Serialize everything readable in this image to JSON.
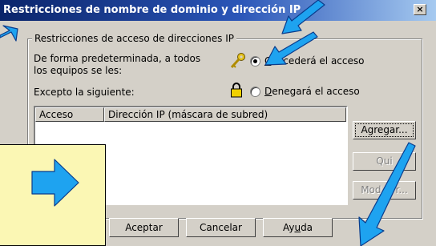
{
  "window": {
    "title": "Restricciones de nombre de dominio y dirección IP",
    "close_glyph": "×"
  },
  "group": {
    "label": "Restricciones de acceso de direcciones IP"
  },
  "default_access": {
    "line1": "De forma predeterminada, a todos",
    "line2": "los equipos se les:"
  },
  "grant_option": {
    "label_pre": "",
    "label_u": "C",
    "label_post": "oncederá el acceso",
    "selected": true
  },
  "deny_option": {
    "label_pre": "",
    "label_u": "D",
    "label_post": "enegará el acceso",
    "selected": false
  },
  "exception_label": "Excepto la siguiente:",
  "table": {
    "columns": [
      "Acceso",
      "Dirección IP (máscara de subred)"
    ],
    "rows": []
  },
  "side_buttons": {
    "add": "Agregar...",
    "remove": "Qui",
    "edit_pre": "Mod",
    "edit_post": "r..."
  },
  "footer": {
    "ok": "Aceptar",
    "cancel": "Cancelar",
    "help_pre": "Ay",
    "help_u": "u",
    "help_post": "da"
  },
  "colors": {
    "callout": "#fbf7b4",
    "arrow": "#1ea3f0",
    "title_start": "#0a246a",
    "title_end": "#a6caf0",
    "face": "#d4d0c8"
  }
}
